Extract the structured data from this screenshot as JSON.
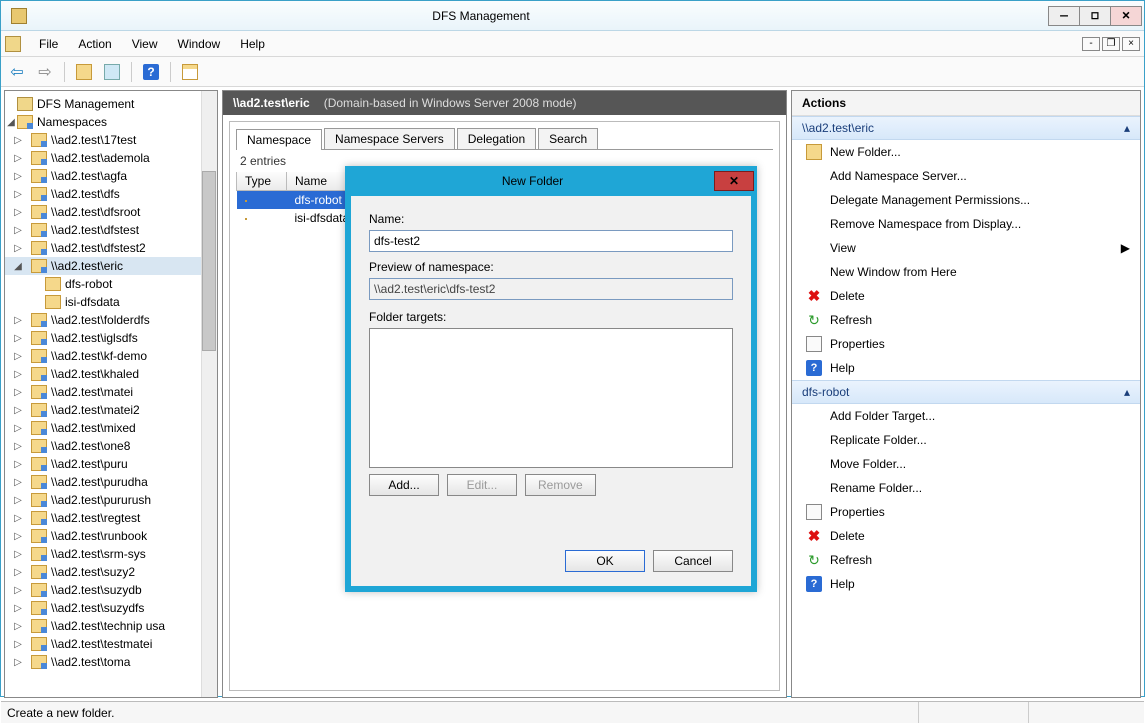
{
  "window": {
    "title": "DFS Management"
  },
  "menu": {
    "file": "File",
    "action": "Action",
    "view": "View",
    "window": "Window",
    "help": "Help"
  },
  "tree": {
    "root": "DFS Management",
    "namespaces": "Namespaces",
    "items": [
      "\\\\ad2.test\\17test",
      "\\\\ad2.test\\ademola",
      "\\\\ad2.test\\agfa",
      "\\\\ad2.test\\dfs",
      "\\\\ad2.test\\dfsroot",
      "\\\\ad2.test\\dfstest",
      "\\\\ad2.test\\dfstest2",
      "\\\\ad2.test\\eric",
      "\\\\ad2.test\\folderdfs",
      "\\\\ad2.test\\iglsdfs",
      "\\\\ad2.test\\kf-demo",
      "\\\\ad2.test\\khaled",
      "\\\\ad2.test\\matei",
      "\\\\ad2.test\\matei2",
      "\\\\ad2.test\\mixed",
      "\\\\ad2.test\\one8",
      "\\\\ad2.test\\puru",
      "\\\\ad2.test\\purudha",
      "\\\\ad2.test\\pururush",
      "\\\\ad2.test\\regtest",
      "\\\\ad2.test\\runbook",
      "\\\\ad2.test\\srm-sys",
      "\\\\ad2.test\\suzy2",
      "\\\\ad2.test\\suzydb",
      "\\\\ad2.test\\suzydfs",
      "\\\\ad2.test\\technip usa",
      "\\\\ad2.test\\testmatei",
      "\\\\ad2.test\\toma"
    ],
    "expandedIndex": 7,
    "children": [
      "dfs-robot",
      "isi-dfsdata"
    ]
  },
  "center": {
    "path": "\\\\ad2.test\\eric",
    "mode": "(Domain-based in Windows Server 2008 mode)",
    "tabs": [
      "Namespace",
      "Namespace Servers",
      "Delegation",
      "Search"
    ],
    "entries": "2 entries",
    "columns": [
      "Type",
      "Name"
    ],
    "rows": [
      {
        "name": "dfs-robot",
        "selected": true
      },
      {
        "name": "isi-dfsdata",
        "selected": false
      }
    ]
  },
  "dialog": {
    "title": "New Folder",
    "name_label": "Name:",
    "name_value": "dfs-test2",
    "preview_label": "Preview of namespace:",
    "preview_value": "\\\\ad2.test\\eric\\dfs-test2",
    "targets_label": "Folder targets:",
    "add": "Add...",
    "edit": "Edit...",
    "remove": "Remove",
    "ok": "OK",
    "cancel": "Cancel"
  },
  "actions": {
    "title": "Actions",
    "group1": "\\\\ad2.test\\eric",
    "g1": [
      "New Folder...",
      "Add Namespace Server...",
      "Delegate Management Permissions...",
      "Remove Namespace from Display...",
      "View",
      "New Window from Here",
      "Delete",
      "Refresh",
      "Properties",
      "Help"
    ],
    "group2": "dfs-robot",
    "g2": [
      "Add Folder Target...",
      "Replicate Folder...",
      "Move Folder...",
      "Rename Folder...",
      "Properties",
      "Delete",
      "Refresh",
      "Help"
    ]
  },
  "status": {
    "msg": "Create a new folder."
  }
}
